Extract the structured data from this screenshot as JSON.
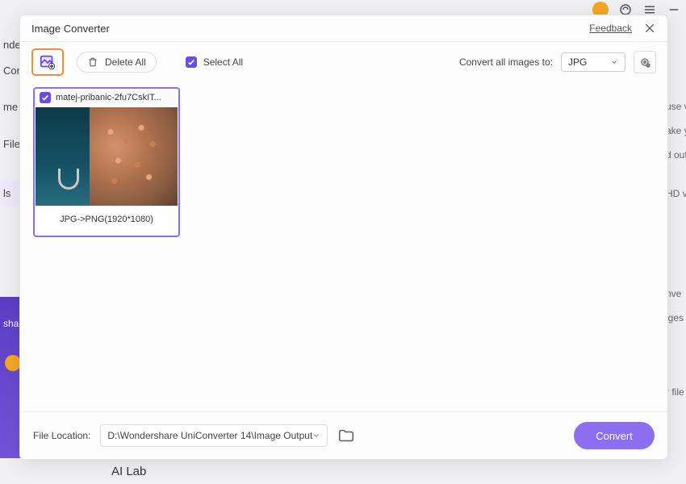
{
  "background": {
    "leftnav": [
      "nde",
      "Con",
      "me",
      "File",
      "ls"
    ],
    "right_snips": [
      "use v",
      "ake y",
      "d out",
      "HD v",
      "nve",
      "iges",
      "r file"
    ],
    "ai_lab": "AI Lab",
    "promo": "shar\nerte"
  },
  "modal": {
    "title": "Image Converter",
    "feedback": "Feedback"
  },
  "toolbar": {
    "delete_all": "Delete All",
    "select_all": "Select All",
    "convert_to_label": "Convert all images to:",
    "format": "JPG"
  },
  "thumbs": [
    {
      "filename": "matej-pribanic-2fu7CskIT...",
      "conversion": "JPG->PNG(1920*1080)",
      "checked": true
    }
  ],
  "footer": {
    "location_label": "File Location:",
    "path": "D:\\Wondershare UniConverter 14\\Image Output",
    "convert": "Convert"
  }
}
